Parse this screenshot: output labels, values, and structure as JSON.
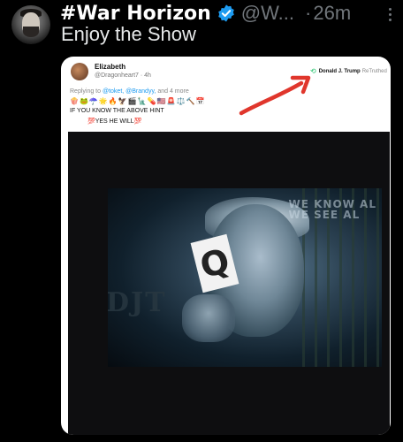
{
  "post": {
    "display_name": "#War Horizon",
    "handle": "@W...",
    "separator": "·",
    "timestamp": "26m",
    "text": "Enjoy the Show",
    "verified_color": "#1d9bf0"
  },
  "embedded": {
    "name": "Elizabeth",
    "handle_time": "@Dragonheart7 · 4h",
    "retweet_name": "Donald J. Trump",
    "retweet_suffix": "ReTruthed",
    "reply_prefix": "Replying to",
    "reply_mentions": "@toket, @Brandyy,",
    "reply_suffix": "and 4 more",
    "emoji_line": "🍿🐸☂️🌟🔥🦅🎬🗽💊🇺🇸🚨⚖️🔨📅",
    "line1": "IF YOU KNOW THE ABOVE HINT",
    "line2": "💯YES HE WILL💯",
    "arrow_color": "#e0362c"
  },
  "image": {
    "card_letter": "Q",
    "overlay_text_1": "WE KNOW AL",
    "overlay_text_2": "WE SEE AL",
    "watermark": "DJT"
  }
}
